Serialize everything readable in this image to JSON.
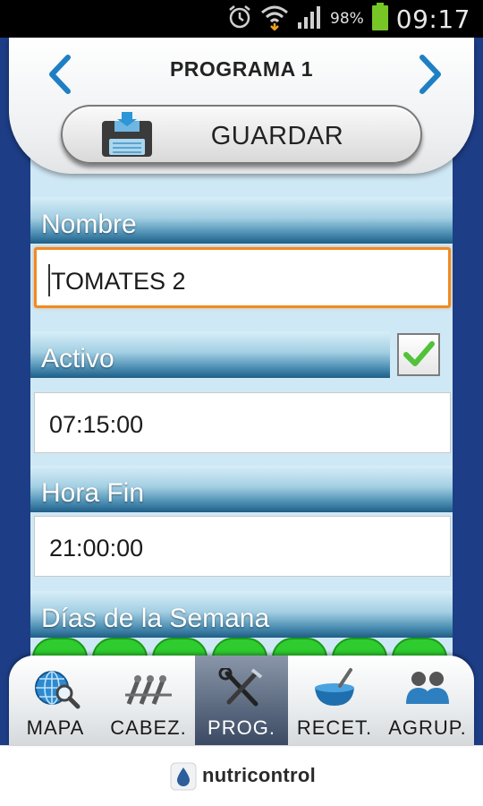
{
  "status_bar": {
    "battery_percent": "98%",
    "time": "09:17",
    "icons": [
      "alarm-icon",
      "wifi-icon",
      "signal-icon",
      "battery-icon"
    ]
  },
  "header": {
    "title": "PROGRAMA 1",
    "prev_icon": "chevron-left-icon",
    "next_icon": "chevron-right-icon",
    "save_label": "GUARDAR",
    "save_icon": "floppy-disk-icon"
  },
  "form": {
    "nombre_label": "Nombre",
    "nombre_value": "TOMATES 2",
    "activo_label": "Activo",
    "activo_checked": true,
    "hora_inicio_value": "07:15:00",
    "hora_fin_label": "Hora Fin",
    "hora_fin_value": "21:00:00",
    "dias_label": "Días de la Semana",
    "days_count": 7
  },
  "tabs": [
    {
      "label": "MAPA",
      "icon": "globe-search-icon",
      "active": false
    },
    {
      "label": "CABEZ.",
      "icon": "valves-icon",
      "active": false
    },
    {
      "label": "PROG.",
      "icon": "tools-icon",
      "active": true
    },
    {
      "label": "RECET.",
      "icon": "mixing-bowl-icon",
      "active": false
    },
    {
      "label": "AGRUP.",
      "icon": "group-icon",
      "active": false
    }
  ],
  "footer": {
    "brand": "nutricontrol"
  },
  "colors": {
    "frame_blue": "#1d3d86",
    "content_bg": "#cfe8f5",
    "accent_arrow": "#1f7fc4",
    "focus_orange": "#f08a24",
    "day_green": "#2fcc2f",
    "check_green": "#52c23a"
  }
}
